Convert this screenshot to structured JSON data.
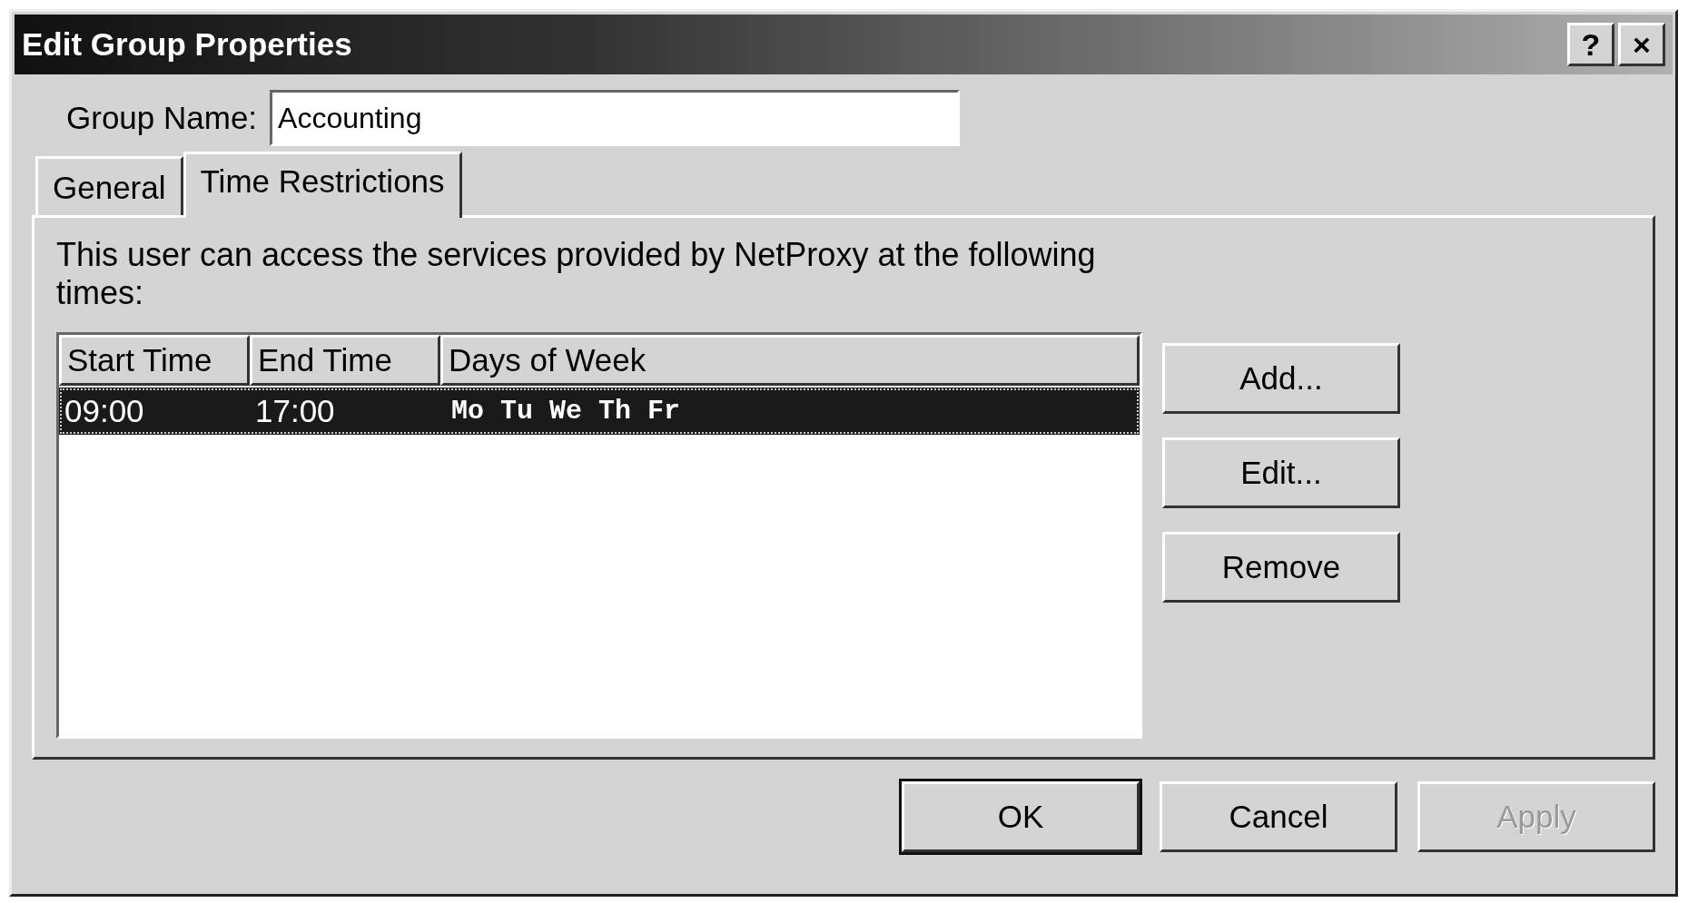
{
  "window": {
    "title": "Edit Group Properties",
    "buttons": [
      "?",
      "×"
    ]
  },
  "group_name": {
    "label": "Group Name:",
    "value": "Accounting"
  },
  "tabs": [
    {
      "label": "General",
      "selected": false
    },
    {
      "label": "Time Restrictions",
      "selected": true
    }
  ],
  "description": "This user can access the services provided by NetProxy at the following times:",
  "table": {
    "columns": [
      "Start Time",
      "End Time",
      "Days of Week"
    ],
    "rows": [
      {
        "cells": [
          "09:00",
          "17:00",
          "Mo Tu We Th Fr"
        ],
        "selected": true
      }
    ]
  },
  "side_buttons": [
    "Add...",
    "Edit...",
    "Remove"
  ],
  "dialog_buttons": [
    {
      "label": "OK",
      "default": true,
      "disabled": false
    },
    {
      "label": "Cancel",
      "default": false,
      "disabled": false
    },
    {
      "label": "Apply",
      "default": false,
      "disabled": true
    }
  ]
}
